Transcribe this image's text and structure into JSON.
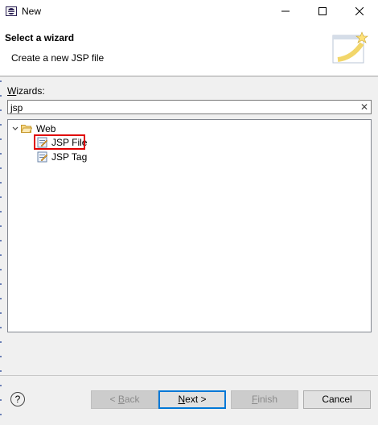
{
  "window": {
    "title": "New",
    "minimize_glyph": "—",
    "maximize_glyph": "☐",
    "close_glyph": "✕"
  },
  "header": {
    "title": "Select a wizard",
    "description": "Create a new JSP file"
  },
  "wizards": {
    "label_accel": "W",
    "label_rest": "izards:",
    "filter_value": "jsp",
    "clear_glyph": "✕"
  },
  "tree": {
    "folder": {
      "label": "Web",
      "expanded": true,
      "twist_glyph": "⌄"
    },
    "items": [
      {
        "label": "JSP File",
        "selected": true
      },
      {
        "label": "JSP Tag",
        "selected": false
      }
    ]
  },
  "footer": {
    "help_glyph": "?",
    "back": {
      "accel": "B",
      "rest": "ack",
      "prefix": "< ",
      "enabled": false
    },
    "next": {
      "accel": "N",
      "rest": "ext",
      "suffix": " >",
      "enabled": true
    },
    "finish": {
      "accel": "F",
      "rest": "inish",
      "enabled": false
    },
    "cancel": {
      "label": "Cancel",
      "enabled": true
    }
  },
  "colors": {
    "highlight_border": "#e00000",
    "default_button_border": "#0078d7",
    "folder": "#e8b54a"
  }
}
